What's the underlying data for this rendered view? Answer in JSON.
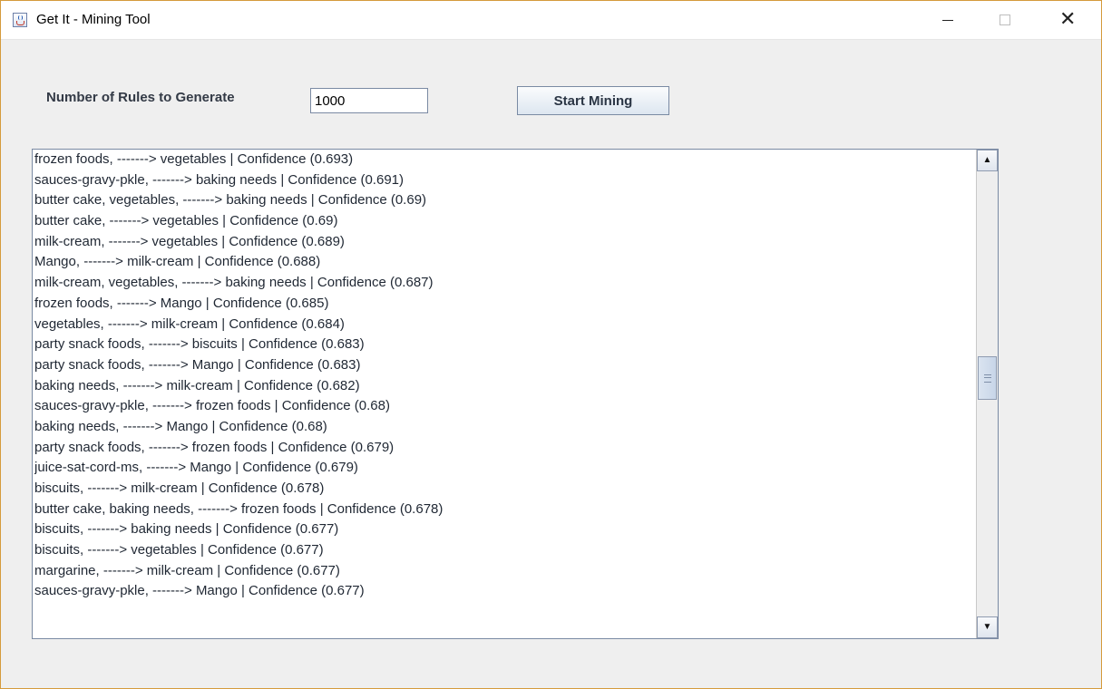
{
  "window": {
    "title": "Get It - Mining Tool",
    "icon": "java-cup-icon",
    "close_glyph": "✕",
    "scroll_up_glyph": "▲",
    "scroll_down_glyph": "▼"
  },
  "controls": {
    "rules_label": "Number of Rules to Generate",
    "rules_value": "1000",
    "start_label": "Start Mining"
  },
  "results": {
    "lines": [
      "frozen foods,  -------> vegetables | Confidence (0.693)",
      "sauces-gravy-pkle,  -------> baking needs | Confidence (0.691)",
      "butter cake, vegetables,  -------> baking needs | Confidence (0.69)",
      "butter cake,  -------> vegetables | Confidence (0.69)",
      "milk-cream,  -------> vegetables | Confidence (0.689)",
      "Mango,  -------> milk-cream | Confidence (0.688)",
      "milk-cream, vegetables,  -------> baking needs | Confidence (0.687)",
      "frozen foods,  -------> Mango | Confidence (0.685)",
      "vegetables,  -------> milk-cream | Confidence (0.684)",
      "party snack foods,  -------> biscuits | Confidence (0.683)",
      "party snack foods,  -------> Mango | Confidence (0.683)",
      "baking needs,  -------> milk-cream | Confidence (0.682)",
      "sauces-gravy-pkle,  -------> frozen foods | Confidence (0.68)",
      "baking needs,  -------> Mango | Confidence (0.68)",
      "party snack foods,  -------> frozen foods | Confidence (0.679)",
      "juice-sat-cord-ms,  -------> Mango | Confidence (0.679)",
      "biscuits,  -------> milk-cream | Confidence (0.678)",
      "butter cake, baking needs,  -------> frozen foods | Confidence (0.678)",
      "biscuits,  -------> baking needs | Confidence (0.677)",
      "biscuits,  -------> vegetables | Confidence (0.677)",
      "margarine,  -------> milk-cream | Confidence (0.677)",
      "sauces-gravy-pkle,  -------> Mango | Confidence (0.677)"
    ],
    "scroll_position": 0.46
  }
}
